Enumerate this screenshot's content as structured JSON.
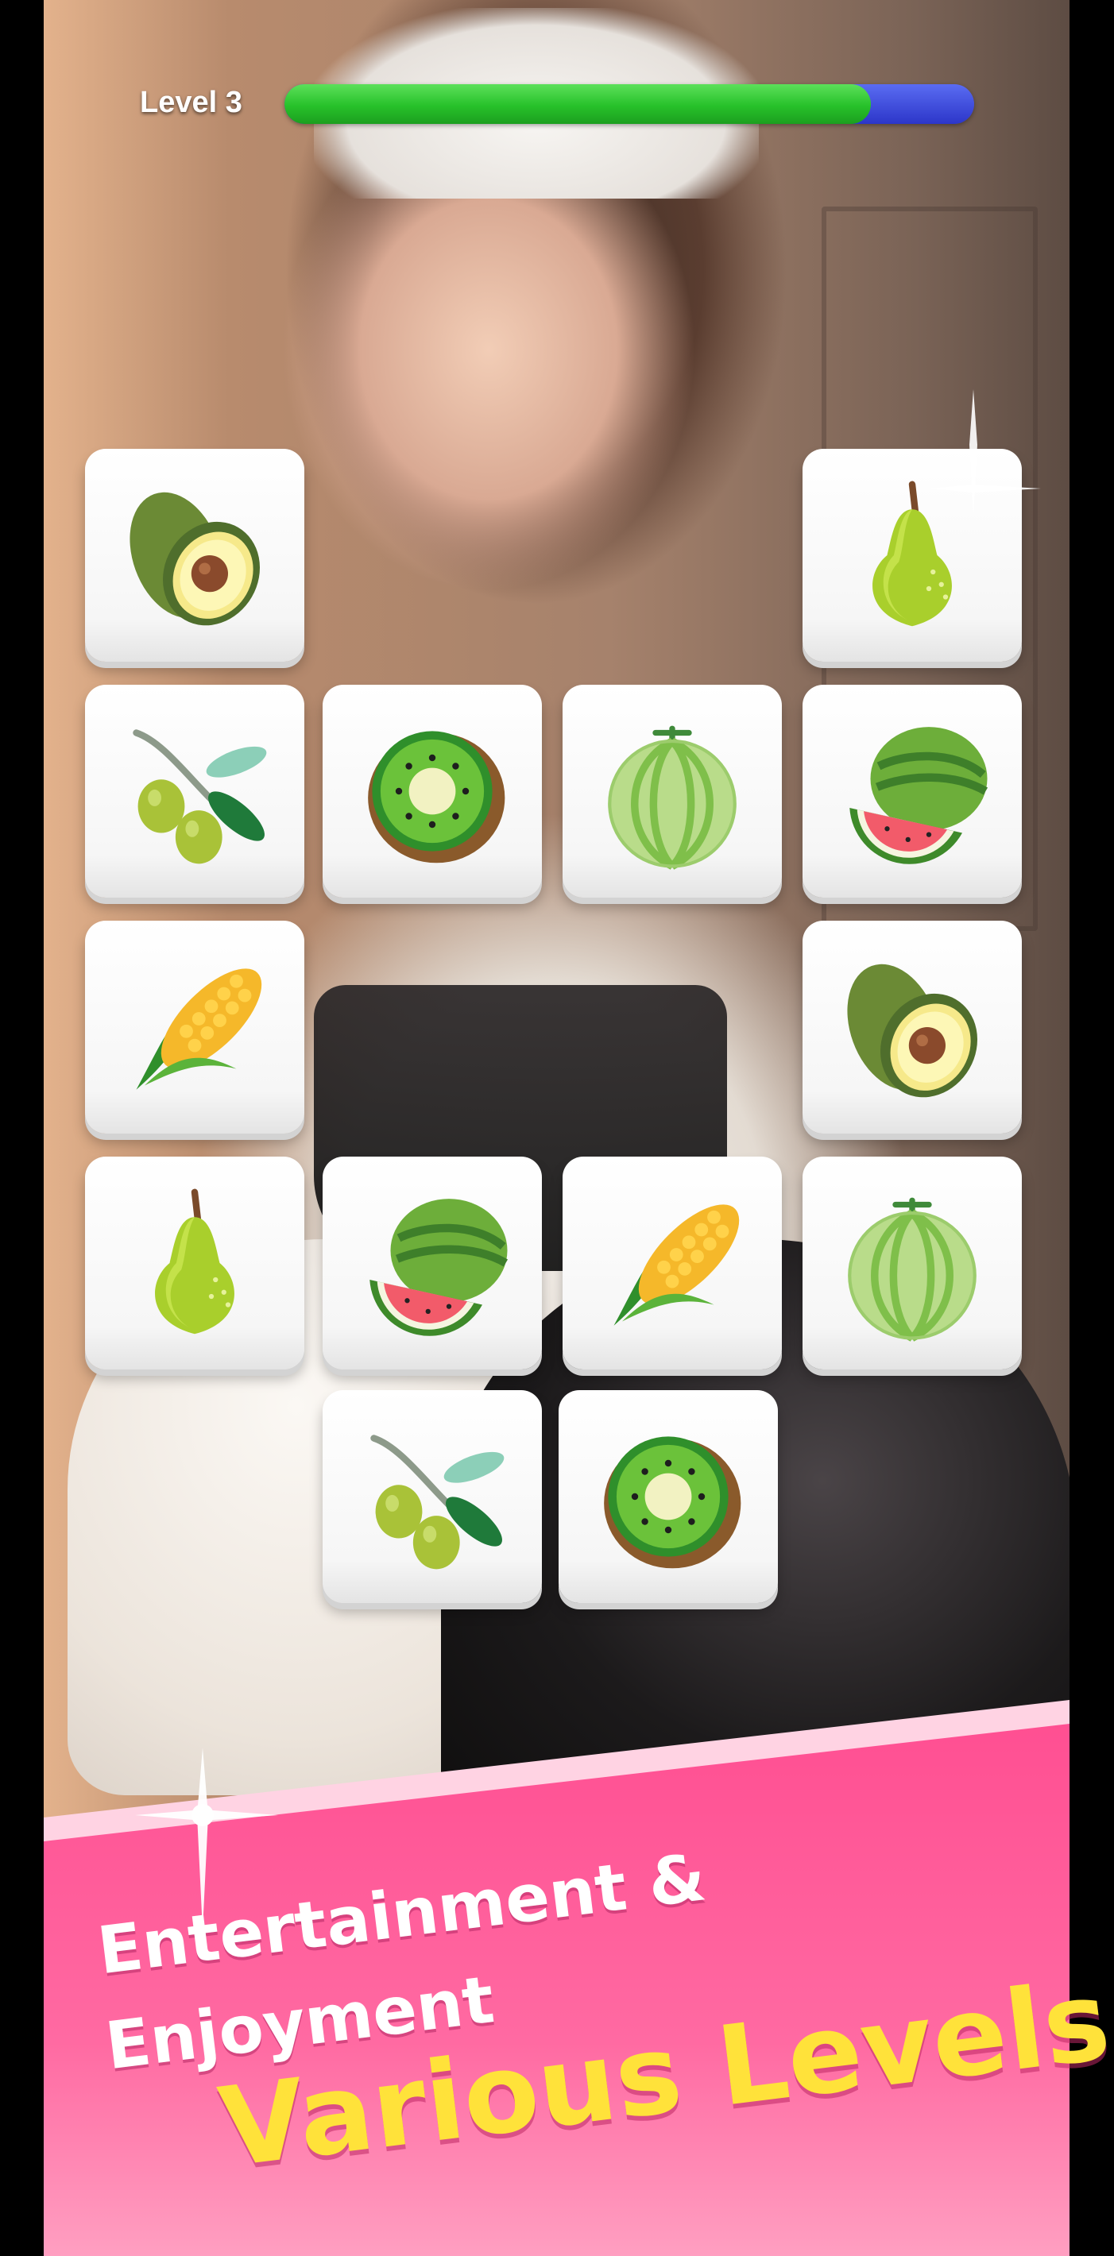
{
  "hud": {
    "level_label": "Level 3",
    "progress": 0.85
  },
  "board": {
    "tiles": [
      {
        "icon": "avocado"
      },
      {
        "icon": "pear"
      },
      {
        "icon": "olives"
      },
      {
        "icon": "kiwi"
      },
      {
        "icon": "melon"
      },
      {
        "icon": "watermelon"
      },
      {
        "icon": "corn"
      },
      {
        "icon": "avocado"
      },
      {
        "icon": "pear"
      },
      {
        "icon": "watermelon"
      },
      {
        "icon": "corn"
      },
      {
        "icon": "melon"
      },
      {
        "icon": "olives"
      },
      {
        "icon": "kiwi"
      }
    ]
  },
  "promo": {
    "line1": "Entertainment &",
    "line2": "Enjoyment",
    "headline": "Various Levels"
  },
  "colors": {
    "progress_fill": "#27c12a",
    "progress_track": "#3b46d8",
    "banner_pink": "#ff6aa2",
    "headline_yellow": "#ffe23a"
  }
}
